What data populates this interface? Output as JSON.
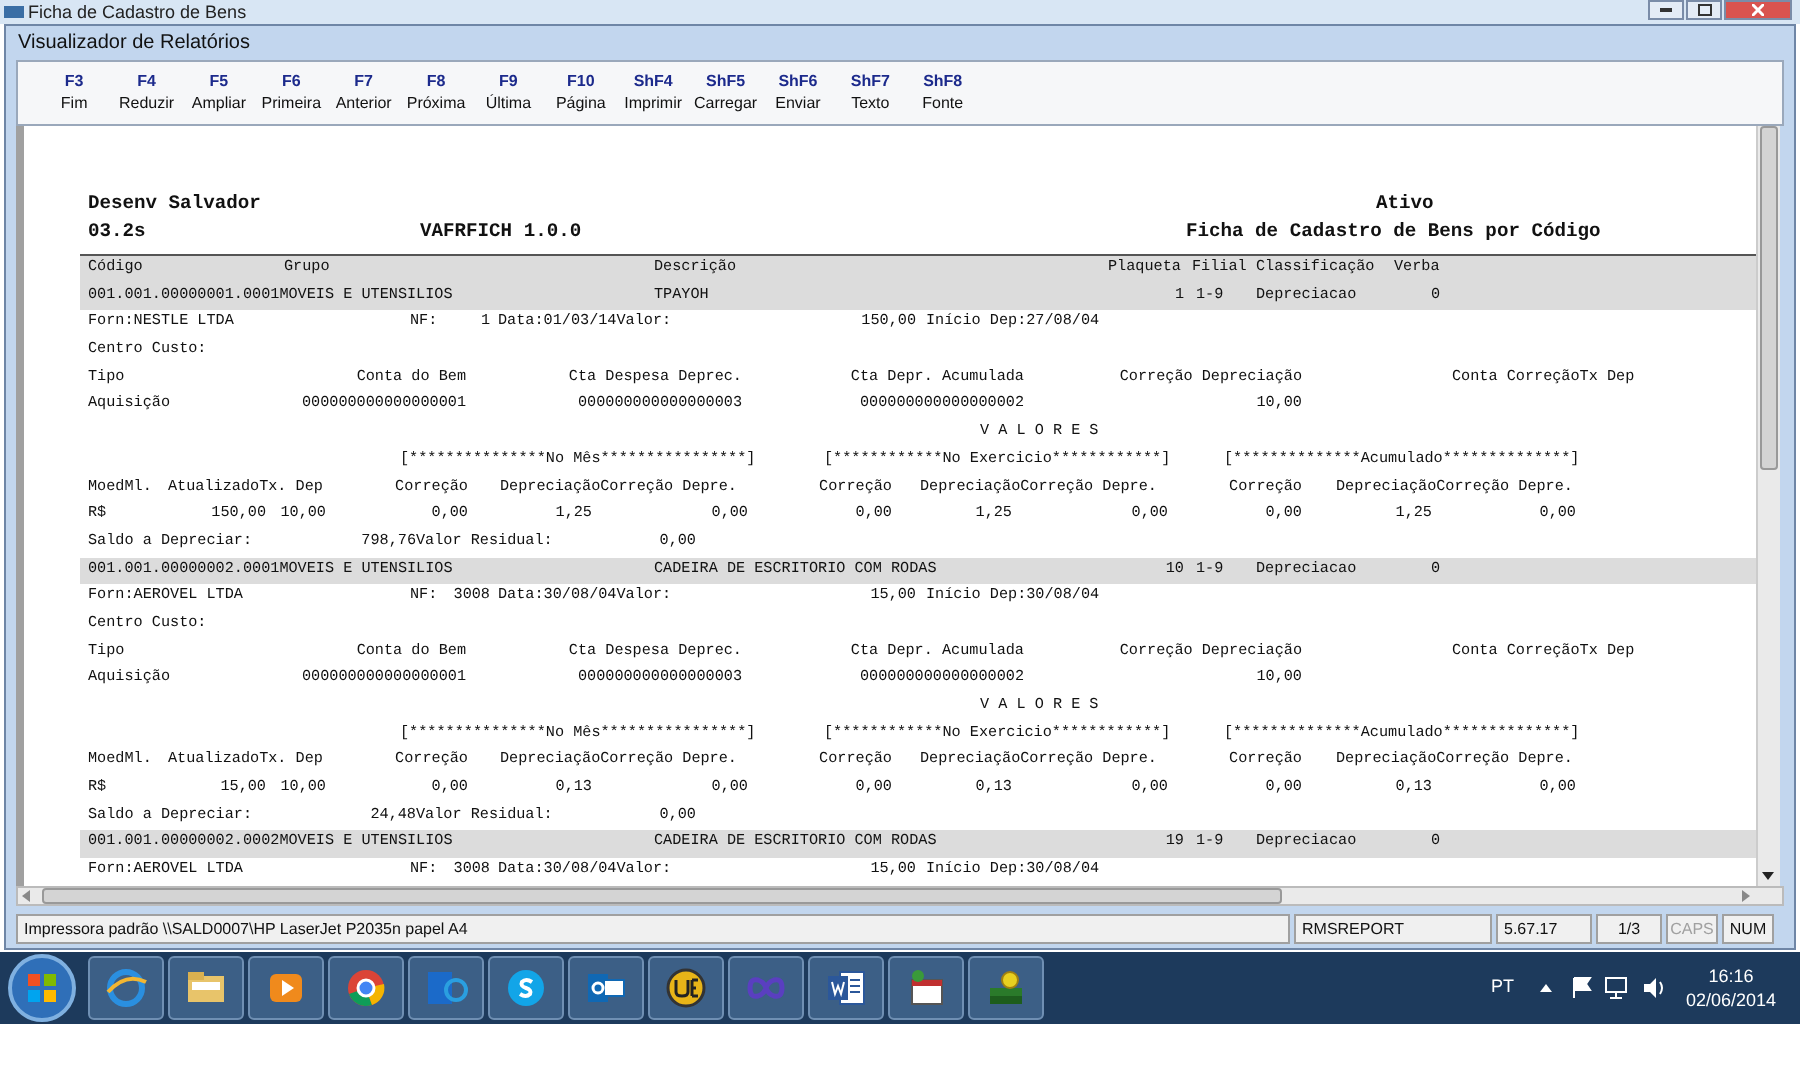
{
  "outer_window": {
    "title": "Ficha de Cadastro de Bens"
  },
  "window": {
    "title": "Visualizador de Relatórios"
  },
  "toolbar": [
    {
      "key": "F3",
      "label": "Fim"
    },
    {
      "key": "F4",
      "label": "Reduzir"
    },
    {
      "key": "F5",
      "label": "Ampliar"
    },
    {
      "key": "F6",
      "label": "Primeira"
    },
    {
      "key": "F7",
      "label": "Anterior"
    },
    {
      "key": "F8",
      "label": "Próxima"
    },
    {
      "key": "F9",
      "label": "Última"
    },
    {
      "key": "F10",
      "label": "Página"
    },
    {
      "key": "ShF4",
      "label": "Imprimir"
    },
    {
      "key": "ShF5",
      "label": "Carregar"
    },
    {
      "key": "ShF6",
      "label": "Enviar"
    },
    {
      "key": "ShF7",
      "label": "Texto"
    },
    {
      "key": "ShF8",
      "label": "Fonte"
    }
  ],
  "report": {
    "header": {
      "company": "Desenv Salvador",
      "version": "03.2s",
      "program": "VAFRFICH 1.0.0",
      "module": "Ativo",
      "title": "Ficha de Cadastro de Bens por Código"
    },
    "lines": [
      {
        "kind": "colhead",
        "cells": [
          "Código",
          "Grupo",
          "Descrição",
          "Plaqueta",
          "Filial",
          "Classificação",
          "Verba"
        ]
      },
      {
        "kind": "asset",
        "cells": [
          "001.001.00000001.0001MOVEIS E UTENSILIOS",
          "TPAYOH",
          "1",
          "1-9",
          "Depreciacao",
          "0"
        ]
      },
      {
        "kind": "supplier",
        "cells": [
          "Forn:NESTLE LTDA",
          "NF:",
          "1",
          "Data:01/03/14Valor:",
          "150,00",
          "Início Dep:27/08/04"
        ]
      },
      {
        "kind": "costcenter",
        "cells": [
          "Centro Custo:"
        ]
      },
      {
        "kind": "accthead",
        "cells": [
          "Tipo",
          "Conta do Bem",
          "Cta Despesa Deprec.",
          "Cta Depr. Acumulada",
          "Correção Depreciação",
          "Conta CorreçãoTx Dep"
        ]
      },
      {
        "kind": "acctvals",
        "cells": [
          "Aquisição",
          "000000000000000001",
          "000000000000000003",
          "000000000000000002",
          "10,00"
        ]
      },
      {
        "kind": "valores",
        "cells": [
          "V A L O R E S"
        ]
      },
      {
        "kind": "periods",
        "cells": [
          "[***************No Mês****************]",
          "[************No Exercicio************]",
          "[**************Acumulado**************]"
        ]
      },
      {
        "kind": "valhead",
        "cells": [
          "MoedMl.",
          "AtualizadoTx. Dep",
          "Correção",
          "DepreciaçãoCorreção Depre.",
          "Correção",
          "DepreciaçãoCorreção Depre.",
          "Correção",
          "DepreciaçãoCorreção Depre."
        ]
      },
      {
        "kind": "vals",
        "cells": [
          "R$",
          "150,00",
          "10,00",
          "0,00",
          "1,25",
          "0,00",
          "0,00",
          "1,25",
          "0,00",
          "0,00",
          "1,25",
          "0,00"
        ]
      },
      {
        "kind": "balance",
        "cells": [
          "Saldo a Depreciar:",
          "798,76",
          "Valor Residual:",
          "0,00"
        ]
      },
      {
        "kind": "asset",
        "cells": [
          "001.001.00000002.0001MOVEIS E UTENSILIOS",
          "CADEIRA DE ESCRITORIO COM RODAS",
          "10",
          "1-9",
          "Depreciacao",
          "0"
        ]
      },
      {
        "kind": "supplier",
        "cells": [
          "Forn:AEROVEL LTDA",
          "NF:",
          "3008",
          "Data:30/08/04Valor:",
          "15,00",
          "Início Dep:30/08/04"
        ]
      },
      {
        "kind": "costcenter",
        "cells": [
          "Centro Custo:"
        ]
      },
      {
        "kind": "accthead",
        "cells": [
          "Tipo",
          "Conta do Bem",
          "Cta Despesa Deprec.",
          "Cta Depr. Acumulada",
          "Correção Depreciação",
          "Conta CorreçãoTx Dep"
        ]
      },
      {
        "kind": "acctvals",
        "cells": [
          "Aquisição",
          "000000000000000001",
          "000000000000000003",
          "000000000000000002",
          "10,00"
        ]
      },
      {
        "kind": "valores",
        "cells": [
          "V A L O R E S"
        ]
      },
      {
        "kind": "periods",
        "cells": [
          "[***************No Mês****************]",
          "[************No Exercicio************]",
          "[**************Acumulado**************]"
        ]
      },
      {
        "kind": "valhead",
        "cells": [
          "MoedMl.",
          "AtualizadoTx. Dep",
          "Correção",
          "DepreciaçãoCorreção Depre.",
          "Correção",
          "DepreciaçãoCorreção Depre.",
          "Correção",
          "DepreciaçãoCorreção Depre."
        ]
      },
      {
        "kind": "vals",
        "cells": [
          "R$",
          "15,00",
          "10,00",
          "0,00",
          "0,13",
          "0,00",
          "0,00",
          "0,13",
          "0,00",
          "0,00",
          "0,13",
          "0,00"
        ]
      },
      {
        "kind": "balance",
        "cells": [
          "Saldo a Depreciar:",
          "24,48",
          "Valor Residual:",
          "0,00"
        ]
      },
      {
        "kind": "asset",
        "cells": [
          "001.001.00000002.0002MOVEIS E UTENSILIOS",
          "CADEIRA DE ESCRITORIO COM RODAS",
          "19",
          "1-9",
          "Depreciacao",
          "0"
        ]
      },
      {
        "kind": "supplier",
        "cells": [
          "Forn:AEROVEL LTDA",
          "NF:",
          "3008",
          "Data:30/08/04Valor:",
          "15,00",
          "Início Dep:30/08/04"
        ]
      }
    ]
  },
  "status_bar": {
    "printer": "Impressora padrão \\\\SALD0007\\HP LaserJet P2035n papel A4",
    "report": "RMSREPORT",
    "version": "5.67.17",
    "page": "1/3",
    "indicators": [
      {
        "label": "CAPS",
        "on": false
      },
      {
        "label": "NUM",
        "on": true
      }
    ]
  },
  "taskbar": {
    "language": "PT",
    "time": "16:16",
    "date": "02/06/2014"
  }
}
